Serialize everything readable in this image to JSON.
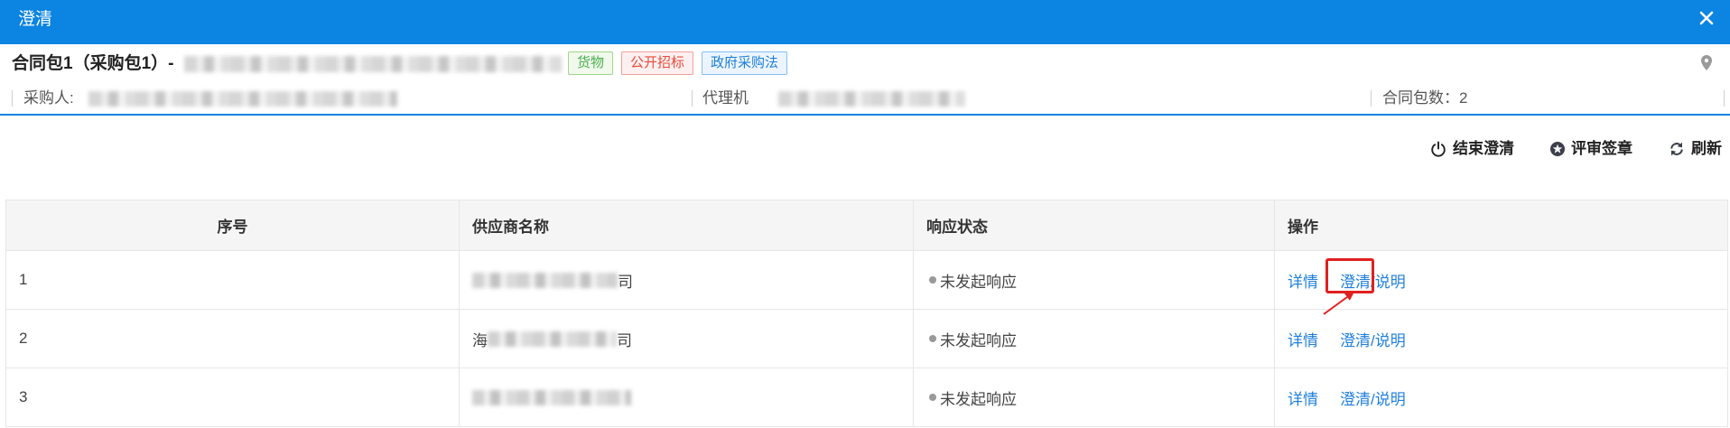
{
  "dialog": {
    "title": "澄清",
    "close_icon": "close-icon"
  },
  "project": {
    "title": "合同包1（采购包1）-",
    "tags": [
      {
        "label": "货物",
        "color": "#4caf50"
      },
      {
        "label": "公开招标",
        "color": "#e74c3c"
      },
      {
        "label": "政府采购法",
        "color": "#1e80d6"
      }
    ],
    "location_icon": "map-pin-icon"
  },
  "info": {
    "purchaser_label": "采购人:",
    "agency_label": "代理机",
    "package_count_label": "合同包数：",
    "package_count": "2"
  },
  "toolbar": {
    "end_clarification": {
      "label": "结束澄清",
      "icon": "power-icon"
    },
    "review_signature": {
      "label": "评审签章",
      "icon": "stamp-icon"
    },
    "refresh": {
      "label": "刷新",
      "icon": "refresh-icon"
    }
  },
  "table": {
    "headers": {
      "index": "序号",
      "supplier": "供应商名称",
      "status": "响应状态",
      "actions": "操作"
    },
    "rows": [
      {
        "index": "1",
        "supplier_end": "司",
        "status": "未发起响应",
        "detail_link": "详情",
        "clarify_link": "澄清/说明"
      },
      {
        "index": "2",
        "supplier_start": "海",
        "supplier_end": "司",
        "status": "未发起响应",
        "detail_link": "详情",
        "clarify_link": "澄清/说明"
      },
      {
        "index": "3",
        "status": "未发起响应",
        "detail_link": "详情",
        "clarify_link": "澄清/说明"
      }
    ]
  },
  "colors": {
    "primary": "#0b84e2",
    "link": "#1f7fdb",
    "status_dot": "#999999",
    "annotation": "#e0201f"
  }
}
